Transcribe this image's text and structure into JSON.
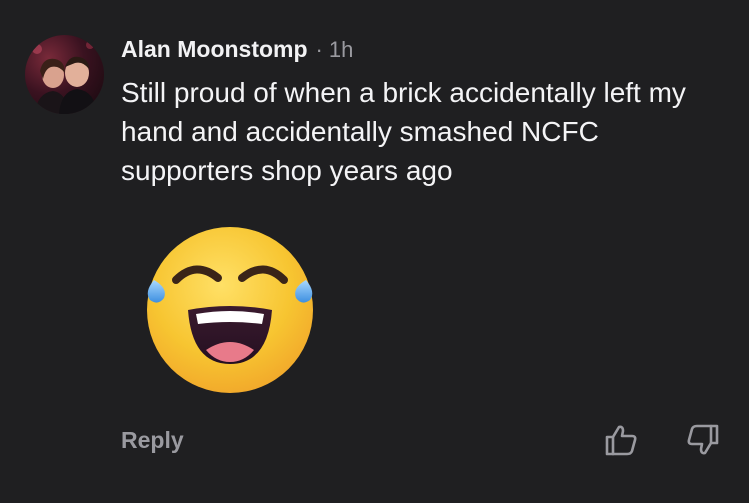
{
  "comment": {
    "author": "Alan Moonstomp",
    "separator": "·",
    "time": "1h",
    "text": "Still proud of when a brick accidentally left my hand and accidentally smashed NCFC supporters shop years ago",
    "emoji": "laughing-with-tears-emoji",
    "avatar_icon": "user-avatar-photo"
  },
  "actions": {
    "reply_label": "Reply",
    "upvote_icon": "thumbs-up-icon",
    "downvote_icon": "thumbs-down-icon"
  },
  "colors": {
    "background": "#1f1f21",
    "text": "#f4f4f6",
    "muted": "#9a9aa0",
    "emoji_face": "#f7c531"
  }
}
